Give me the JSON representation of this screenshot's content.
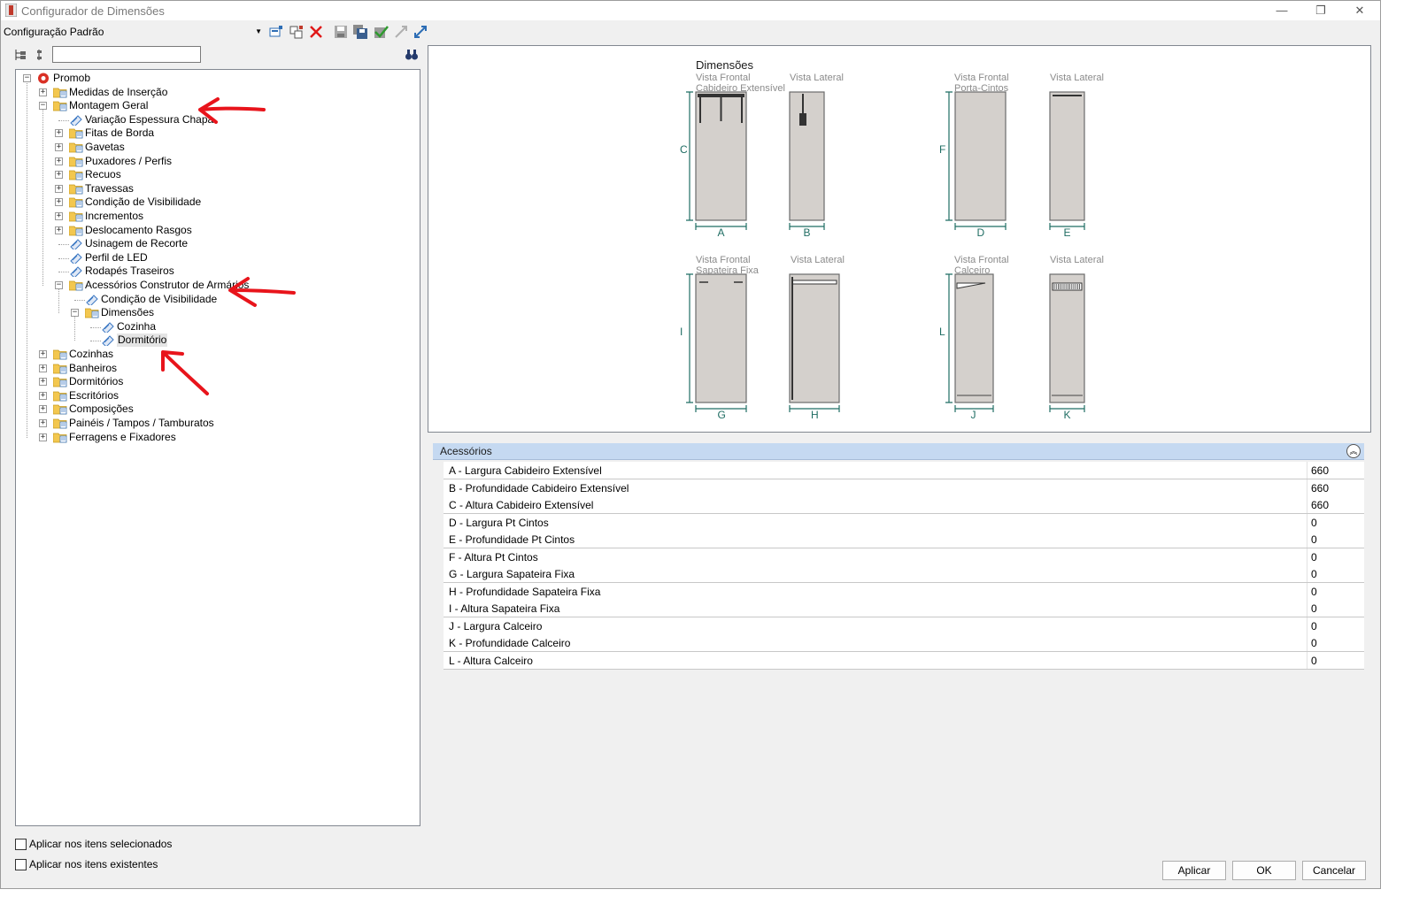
{
  "window": {
    "title": "Configurador de Dimensões",
    "minimize_glyph": "—",
    "restore_glyph": "❐",
    "close_glyph": "✕"
  },
  "toolbar": {
    "config_value": "Configuração Padrão",
    "icons": [
      "new-config-icon",
      "copy-config-icon",
      "delete-icon",
      "save-icon",
      "save-all-icon",
      "apply-check-icon",
      "shrink-icon",
      "expand-icon"
    ]
  },
  "tree": {
    "nodes": [
      {
        "label": "Promob",
        "expander": "−"
      },
      {
        "label": "Medidas de Inserção",
        "expander": "+"
      },
      {
        "label": "Montagem Geral",
        "expander": "−"
      },
      {
        "label": "Variação Espessura Chapa",
        "expander": ""
      },
      {
        "label": "Fitas de Borda",
        "expander": "+"
      },
      {
        "label": "Gavetas",
        "expander": "+"
      },
      {
        "label": "Puxadores / Perfis",
        "expander": "+"
      },
      {
        "label": "Recuos",
        "expander": "+"
      },
      {
        "label": "Travessas",
        "expander": "+"
      },
      {
        "label": "Condição de Visibilidade",
        "expander": "+"
      },
      {
        "label": "Incrementos",
        "expander": "+"
      },
      {
        "label": "Deslocamento Rasgos",
        "expander": "+"
      },
      {
        "label": "Usinagem de Recorte",
        "expander": ""
      },
      {
        "label": "Perfil de LED",
        "expander": ""
      },
      {
        "label": "Rodapés Traseiros",
        "expander": ""
      },
      {
        "label": "Acessórios Construtor de Armários",
        "expander": "−"
      },
      {
        "label": "Condição de Visibilidade",
        "expander": ""
      },
      {
        "label": "Dimensões",
        "expander": "−"
      },
      {
        "label": "Cozinha",
        "expander": ""
      },
      {
        "label": "Dormitório",
        "expander": ""
      },
      {
        "label": "Cozinhas",
        "expander": "+"
      },
      {
        "label": "Banheiros",
        "expander": "+"
      },
      {
        "label": "Dormitórios",
        "expander": "+"
      },
      {
        "label": "Escritórios",
        "expander": "+"
      },
      {
        "label": "Composições",
        "expander": "+"
      },
      {
        "label": "Painéis / Tampos / Tamburatos",
        "expander": "+"
      },
      {
        "label": "Ferragens e Fixadores",
        "expander": "+"
      }
    ]
  },
  "preview": {
    "title": "Dimensões",
    "views": [
      {
        "view": "Vista Frontal",
        "sub": "Cabideiro Extensível",
        "dim_w": "A",
        "dim_h": "C"
      },
      {
        "view": "Vista Lateral",
        "sub": "",
        "dim_w": "B",
        "dim_h": ""
      },
      {
        "view": "Vista Frontal",
        "sub": "Porta-Cintos",
        "dim_w": "D",
        "dim_h": "F"
      },
      {
        "view": "Vista Lateral",
        "sub": "",
        "dim_w": "E",
        "dim_h": ""
      },
      {
        "view": "Vista Frontal",
        "sub": "Sapateira Fixa",
        "dim_w": "G",
        "dim_h": "I"
      },
      {
        "view": "Vista Lateral",
        "sub": "",
        "dim_w": "H",
        "dim_h": ""
      },
      {
        "view": "Vista Frontal",
        "sub": "Calceiro",
        "dim_w": "J",
        "dim_h": "L"
      },
      {
        "view": "Vista Lateral",
        "sub": "",
        "dim_w": "K",
        "dim_h": ""
      }
    ]
  },
  "properties": {
    "section": "Acessórios",
    "collapse_glyph": "︽",
    "rows": [
      {
        "label": "A -  Largura Cabideiro Extensível",
        "value": "660"
      },
      {
        "label": "B -  Profundidade Cabideiro Extensível",
        "value": "660"
      },
      {
        "label": "C -  Altura Cabideiro Extensível",
        "value": "660"
      },
      {
        "label": "D -  Largura Pt Cintos",
        "value": "0"
      },
      {
        "label": "E -  Profundidade Pt Cintos",
        "value": "0"
      },
      {
        "label": "F -  Altura Pt Cintos",
        "value": "0"
      },
      {
        "label": "G -  Largura Sapateira Fixa",
        "value": "0"
      },
      {
        "label": "H -  Profundidade Sapateira Fixa",
        "value": "0"
      },
      {
        "label": "I -  Altura Sapateira Fixa",
        "value": "0"
      },
      {
        "label": "J -  Largura Calceiro",
        "value": "0"
      },
      {
        "label": "K -  Profundidade Calceiro",
        "value": "0"
      },
      {
        "label": "L -  Altura Calceiro",
        "value": "0"
      }
    ]
  },
  "options": {
    "apply_selected": "Aplicar nos itens selecionados",
    "apply_existing": "Aplicar nos itens existentes"
  },
  "buttons": {
    "apply": "Aplicar",
    "ok": "OK",
    "cancel": "Cancelar"
  },
  "colors": {
    "annotation_arrow": "#e8141b",
    "dimension_line": "#1f6d63",
    "header_blue": "#c5d9f1",
    "panel_fill": "#d4d0cc"
  }
}
